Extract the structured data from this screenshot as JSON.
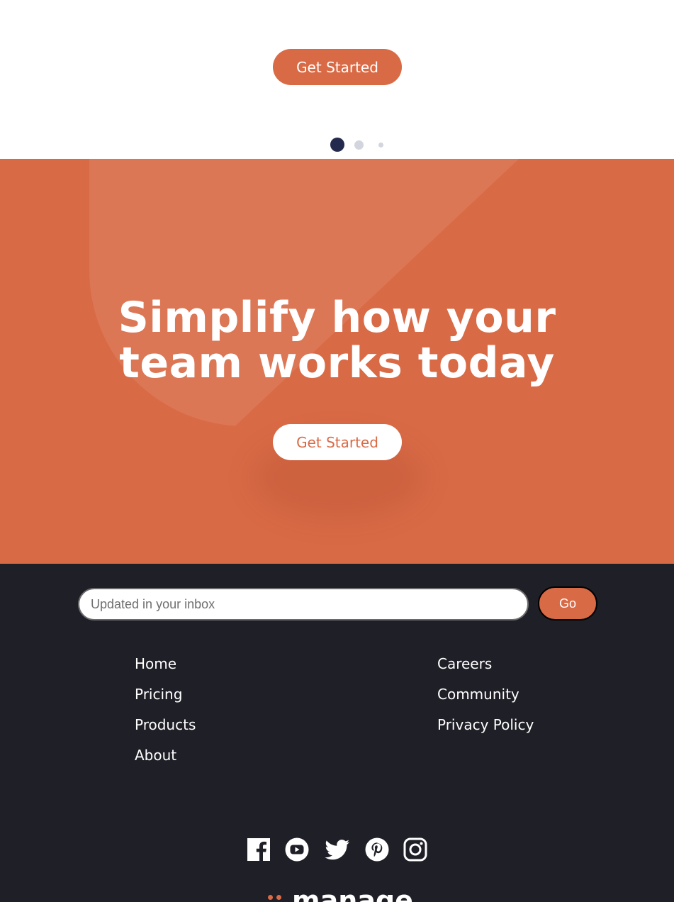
{
  "hero": {
    "cta_label": "Get Started",
    "slider_dots": [
      {
        "active": true
      },
      {
        "active": false
      },
      {
        "active": false
      }
    ]
  },
  "cta_section": {
    "title_line1": "Simplify how your",
    "title_line2": "team works today",
    "button_label": "Get Started"
  },
  "footer": {
    "newsletter": {
      "placeholder": "Updated in your inbox",
      "value": "",
      "submit_label": "Go"
    },
    "links_left": [
      "Home",
      "Pricing",
      "Products",
      "About"
    ],
    "links_right": [
      "Careers",
      "Community",
      "Privacy Policy"
    ],
    "social_icons": [
      "facebook-icon",
      "youtube-icon",
      "twitter-icon",
      "pinterest-icon",
      "instagram-icon"
    ],
    "logo_text": "manage"
  },
  "colors": {
    "accent": "#d96a46",
    "dark": "#1f1f27",
    "dot_active": "#232a4d",
    "dot_inactive": "#d3d5de",
    "white": "#ffffff"
  }
}
